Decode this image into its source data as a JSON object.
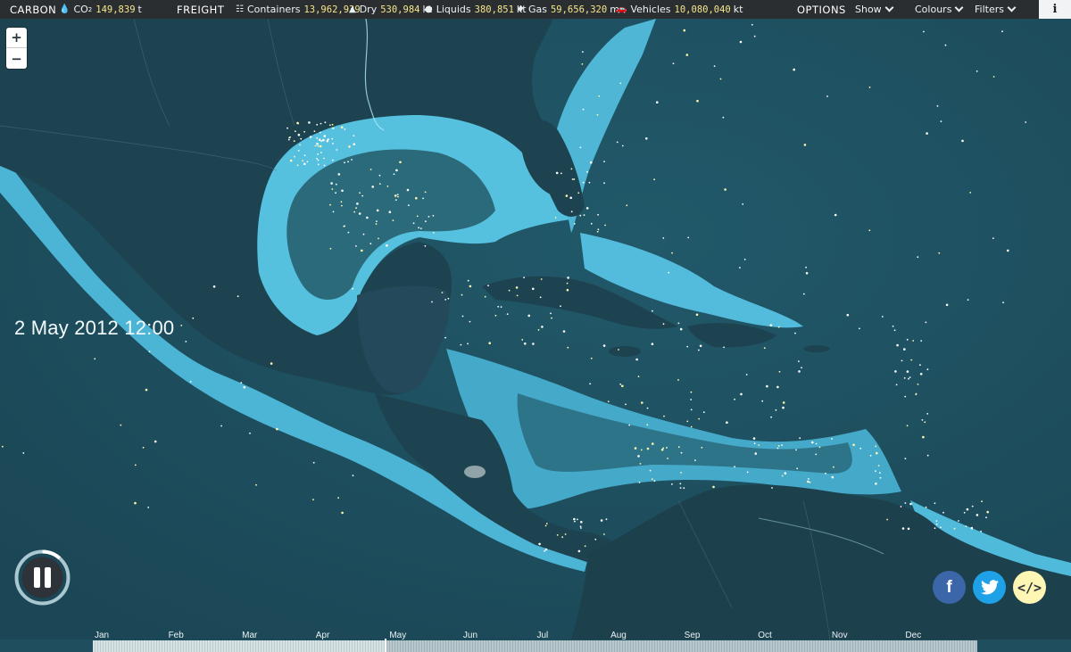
{
  "topbar": {
    "carbon_label": "CARBON",
    "co2_label": "CO",
    "co2_sub": "2",
    "co2_value": "149,839",
    "co2_unit": "t",
    "freight_label": "FREIGHT",
    "containers_label": "Containers",
    "containers_value": "13,962,939",
    "dry_label": "Dry",
    "dry_value": "530,984",
    "dry_unit": "kt",
    "liquids_label": "Liquids",
    "liquids_value": "380,851",
    "liquids_unit": "kt",
    "gas_label": "Gas",
    "gas_value": "59,656,320",
    "gas_unit": "m",
    "gas_unit_sup": "3",
    "vehicles_label": "Vehicles",
    "vehicles_value": "10,080,040",
    "vehicles_unit": "kt",
    "options_label": "OPTIONS",
    "show_label": "Show",
    "colours_label": "Colours",
    "filters_label": "Filters",
    "info_label": "i"
  },
  "zoom": {
    "in_label": "+",
    "out_label": "−"
  },
  "datetime": "2 May 2012 12:00",
  "playback": {
    "state": "playing",
    "progress": 0.33
  },
  "timeline": {
    "months": [
      "Jan",
      "Feb",
      "Mar",
      "Apr",
      "May",
      "Jun",
      "Jul",
      "Aug",
      "Sep",
      "Oct",
      "Nov",
      "Dec"
    ],
    "current_month_index": 4
  },
  "social": {
    "facebook": "f",
    "twitter": "twitter-bird",
    "embed": "</>"
  },
  "colors": {
    "ocean": "#1f5363",
    "shelf": "#55bfdf",
    "land": "#1c3e4a",
    "topbar": "#2a2e31",
    "value": "#f5e78a",
    "facebook": "#3b66a8",
    "twitter": "#1ea1e6",
    "embed": "#fdf6b4"
  }
}
